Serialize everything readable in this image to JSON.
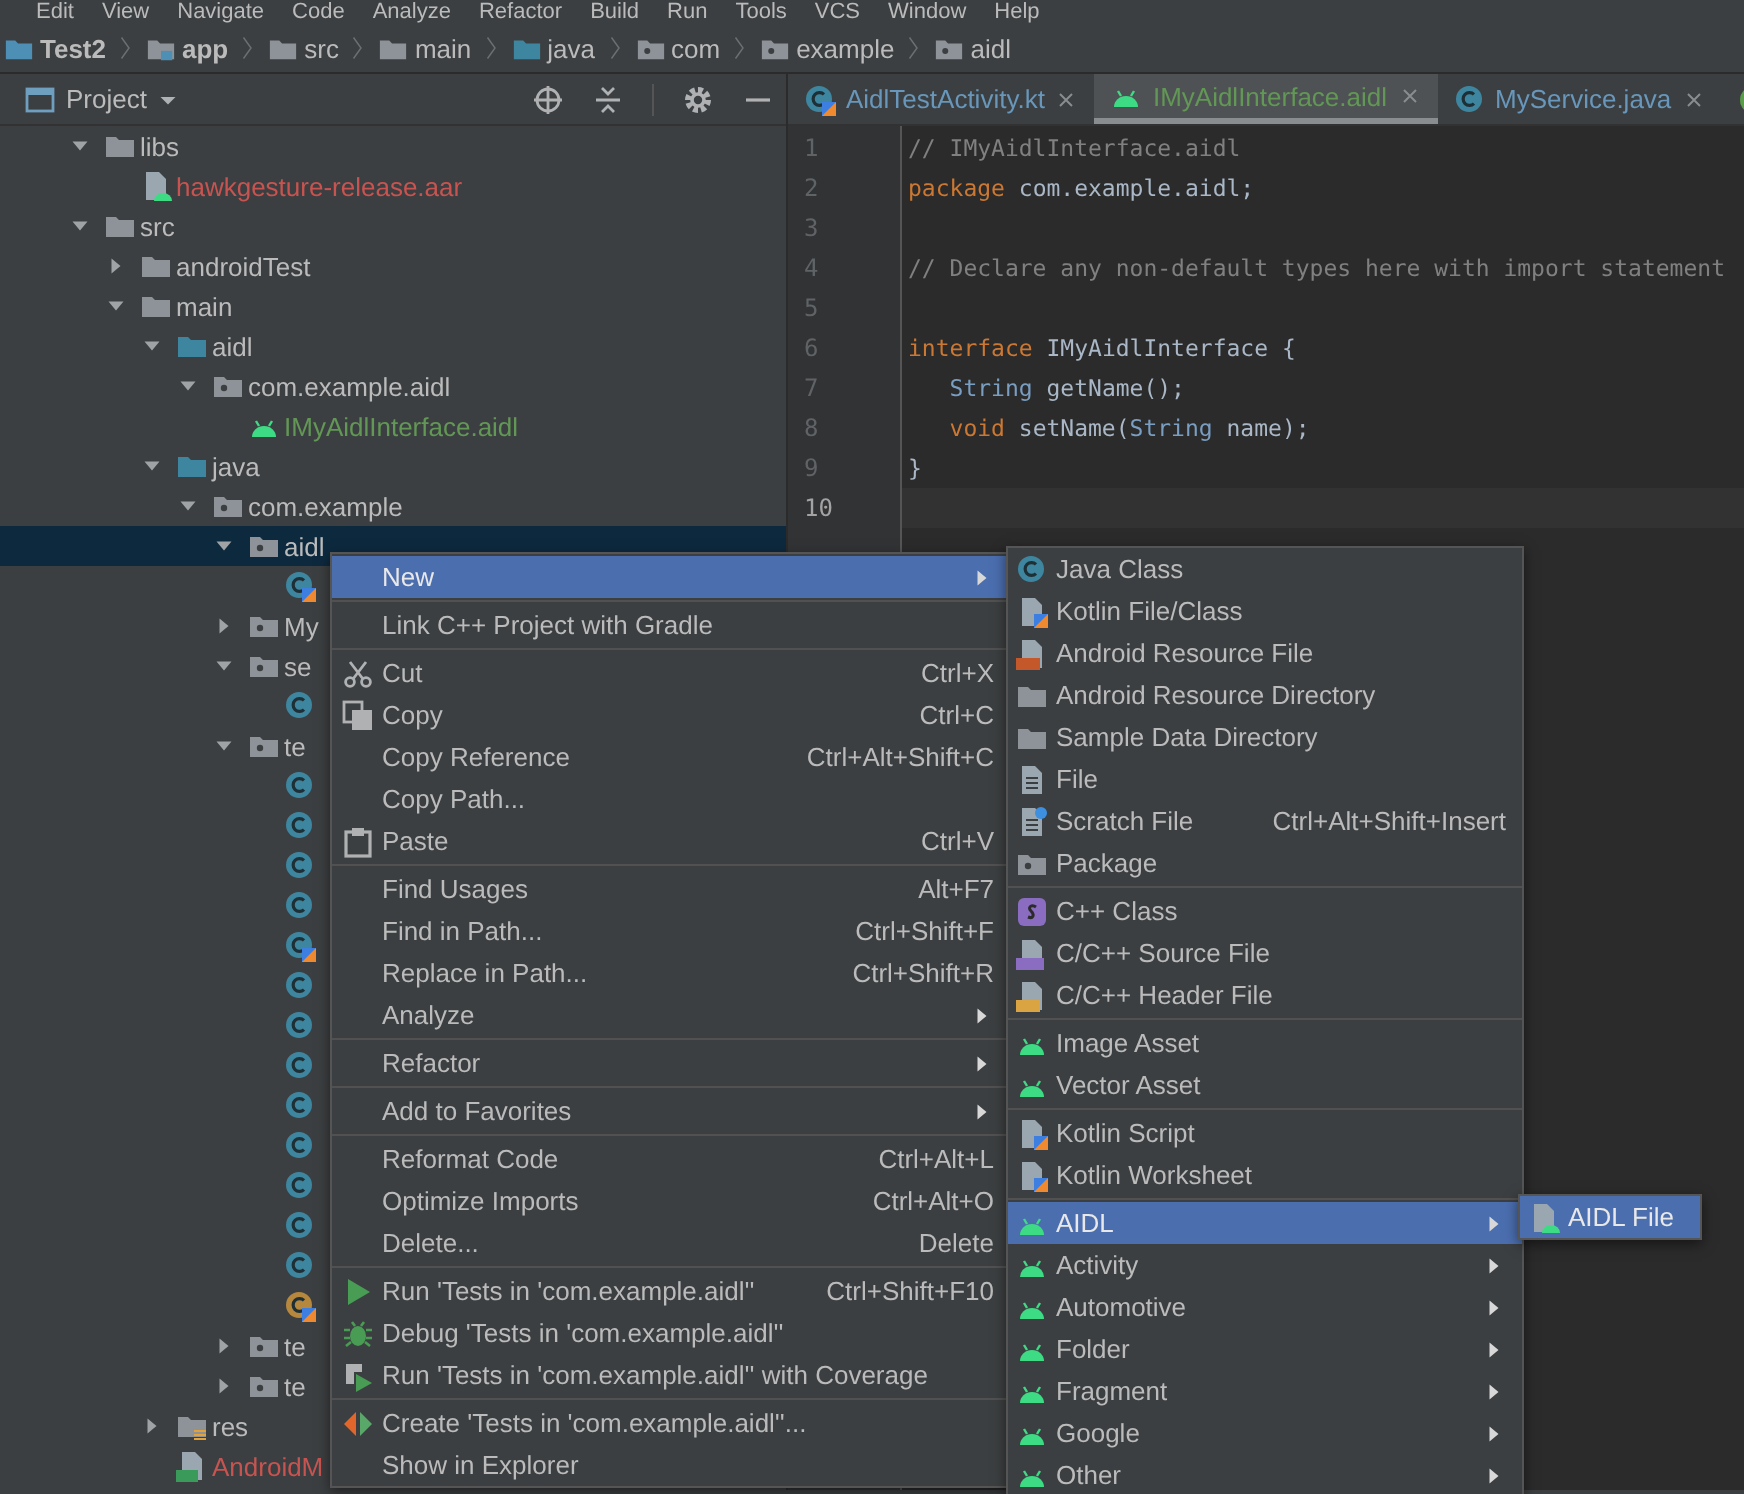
{
  "menu_bar": [
    "Edit",
    "View",
    "Navigate",
    "Code",
    "Analyze",
    "Refactor",
    "Build",
    "Run",
    "Tools",
    "VCS",
    "Window",
    "Help"
  ],
  "breadcrumbs": [
    {
      "label": "Test2",
      "kind": "project"
    },
    {
      "label": "app",
      "kind": "module"
    },
    {
      "label": "src",
      "kind": "folder"
    },
    {
      "label": "main",
      "kind": "folder"
    },
    {
      "label": "java",
      "kind": "source-folder"
    },
    {
      "label": "com",
      "kind": "package"
    },
    {
      "label": "example",
      "kind": "package"
    },
    {
      "label": "aidl",
      "kind": "package"
    }
  ],
  "project_panel": {
    "title": "Project"
  },
  "tree": [
    {
      "label": "libs",
      "kind": "folder",
      "expanded": true,
      "selected": false,
      "children": [
        {
          "label": "hawkgesture-release.aar",
          "kind": "aar",
          "color": "#c75450",
          "selected": false
        }
      ]
    },
    {
      "label": "src",
      "kind": "folder",
      "expanded": true,
      "selected": false,
      "children": [
        {
          "label": "androidTest",
          "kind": "folder",
          "expanded": false,
          "selected": false
        },
        {
          "label": "main",
          "kind": "folder",
          "expanded": true,
          "selected": false,
          "children": [
            {
              "label": "aidl",
              "kind": "source-folder",
              "expanded": true,
              "selected": false,
              "children": [
                {
                  "label": "com.example.aidl",
                  "kind": "package",
                  "expanded": true,
                  "selected": false,
                  "children": [
                    {
                      "label": "IMyAidlInterface.aidl",
                      "kind": "android",
                      "color": "#629755",
                      "selected": false
                    }
                  ]
                }
              ]
            },
            {
              "label": "java",
              "kind": "source-folder",
              "expanded": true,
              "selected": false,
              "children": [
                {
                  "label": "com.example",
                  "kind": "package",
                  "expanded": true,
                  "selected": false,
                  "children": [
                    {
                      "label": "aidl",
                      "kind": "package",
                      "expanded": true,
                      "selected": true,
                      "children": [
                        {
                          "kind": "kotlin-class",
                          "selected": false
                        }
                      ]
                    },
                    {
                      "label": "My",
                      "kind": "package",
                      "expanded": false,
                      "selected": false
                    },
                    {
                      "label": "se",
                      "kind": "package",
                      "expanded": true,
                      "selected": false,
                      "children": [
                        {
                          "kind": "class",
                          "selected": false
                        }
                      ]
                    },
                    {
                      "label": "te",
                      "kind": "package",
                      "expanded": true,
                      "selected": false,
                      "children": [
                        {
                          "kind": "class",
                          "selected": false
                        },
                        {
                          "kind": "class",
                          "selected": false
                        },
                        {
                          "kind": "class",
                          "selected": false
                        },
                        {
                          "kind": "class",
                          "selected": false
                        },
                        {
                          "kind": "kotlin-class",
                          "selected": false
                        },
                        {
                          "kind": "class",
                          "selected": false
                        },
                        {
                          "kind": "class",
                          "selected": false
                        },
                        {
                          "kind": "class",
                          "selected": false
                        },
                        {
                          "kind": "class",
                          "selected": false
                        },
                        {
                          "kind": "class",
                          "selected": false
                        },
                        {
                          "kind": "class",
                          "selected": false
                        },
                        {
                          "kind": "class",
                          "selected": false
                        },
                        {
                          "kind": "class",
                          "selected": false
                        },
                        {
                          "kind": "kotlin-object",
                          "selected": false
                        }
                      ]
                    },
                    {
                      "label": "te",
                      "kind": "package",
                      "expanded": false,
                      "selected": false
                    },
                    {
                      "label": "te",
                      "kind": "package",
                      "expanded": false,
                      "selected": false
                    }
                  ]
                }
              ]
            },
            {
              "label": "res",
              "kind": "res-folder",
              "expanded": false,
              "selected": false
            },
            {
              "label": "AndroidM",
              "kind": "manifest",
              "color": "#c75450",
              "selected": false
            }
          ]
        }
      ]
    }
  ],
  "editor_tabs": [
    {
      "label": "AidlTestActivity.kt",
      "kind": "kotlin-class",
      "color": "#6897bb",
      "selected": false
    },
    {
      "label": "IMyAidlInterface.aidl",
      "kind": "android",
      "color": "#629755",
      "selected": true
    },
    {
      "label": "MyService.java",
      "kind": "class",
      "color": "#6897bb",
      "selected": false
    },
    {
      "kind": "interface",
      "selected": false
    }
  ],
  "editor_lines": [
    {
      "number": "1",
      "current": false,
      "segments": [
        {
          "kind": "comment",
          "text": "// IMyAidlInterface.aidl"
        }
      ]
    },
    {
      "number": "2",
      "current": false,
      "segments": [
        {
          "kind": "keyword",
          "text": "package "
        },
        {
          "kind": "plain",
          "text": "com.example.aidl;"
        }
      ]
    },
    {
      "number": "3",
      "current": false
    },
    {
      "number": "4",
      "current": false,
      "segments": [
        {
          "kind": "comment",
          "text": "// Declare any non-default types here with import statement"
        }
      ]
    },
    {
      "number": "5",
      "current": false
    },
    {
      "number": "6",
      "current": false,
      "segments": [
        {
          "kind": "keyword",
          "text": "interface "
        },
        {
          "kind": "plain",
          "text": "IMyAidlInterface {"
        }
      ]
    },
    {
      "number": "7",
      "current": false,
      "segments": [
        {
          "kind": "type",
          "text": "   String "
        },
        {
          "kind": "plain",
          "text": "getName();"
        }
      ]
    },
    {
      "number": "8",
      "current": false,
      "segments": [
        {
          "kind": "keyword",
          "text": "   void "
        },
        {
          "kind": "plain",
          "text": "setName("
        },
        {
          "kind": "type",
          "text": "String "
        },
        {
          "kind": "plain",
          "text": "name);"
        }
      ]
    },
    {
      "number": "9",
      "current": false,
      "segments": [
        {
          "kind": "plain",
          "text": "}"
        }
      ]
    },
    {
      "number": "10",
      "current": true
    }
  ],
  "context_menu": [
    {
      "kind": "text",
      "label": "New",
      "submenu": true,
      "selected": true
    },
    {
      "kind": "separator"
    },
    {
      "kind": "text",
      "label": "Link C++ Project with Gradle",
      "selected": false
    },
    {
      "kind": "separator"
    },
    {
      "kind": "scissors",
      "label": "Cut",
      "shortcut": "Ctrl+X",
      "selected": false
    },
    {
      "kind": "copy",
      "label": "Copy",
      "shortcut": "Ctrl+C",
      "selected": false
    },
    {
      "kind": "text",
      "label": "Copy Reference",
      "shortcut": "Ctrl+Alt+Shift+C",
      "selected": false
    },
    {
      "kind": "text",
      "label": "Copy Path...",
      "selected": false
    },
    {
      "kind": "paste",
      "label": "Paste",
      "shortcut": "Ctrl+V",
      "selected": false
    },
    {
      "kind": "separator"
    },
    {
      "kind": "text",
      "label": "Find Usages",
      "shortcut": "Alt+F7",
      "selected": false
    },
    {
      "kind": "text",
      "label": "Find in Path...",
      "shortcut": "Ctrl+Shift+F",
      "selected": false
    },
    {
      "kind": "text",
      "label": "Replace in Path...",
      "shortcut": "Ctrl+Shift+R",
      "selected": false
    },
    {
      "kind": "text",
      "label": "Analyze",
      "submenu": true,
      "selected": false
    },
    {
      "kind": "separator"
    },
    {
      "kind": "text",
      "label": "Refactor",
      "submenu": true,
      "selected": false
    },
    {
      "kind": "separator"
    },
    {
      "kind": "text",
      "label": "Add to Favorites",
      "submenu": true,
      "selected": false
    },
    {
      "kind": "separator"
    },
    {
      "kind": "text",
      "label": "Reformat Code",
      "shortcut": "Ctrl+Alt+L",
      "selected": false
    },
    {
      "kind": "text",
      "label": "Optimize Imports",
      "shortcut": "Ctrl+Alt+O",
      "selected": false
    },
    {
      "kind": "text",
      "label": "Delete...",
      "shortcut": "Delete",
      "selected": false
    },
    {
      "kind": "separator"
    },
    {
      "kind": "run",
      "label": "Run 'Tests in 'com.example.aidl''",
      "shortcut": "Ctrl+Shift+F10",
      "selected": false
    },
    {
      "kind": "debug",
      "label": "Debug 'Tests in 'com.example.aidl''",
      "selected": false
    },
    {
      "kind": "coverage",
      "label": "Run 'Tests in 'com.example.aidl'' with Coverage",
      "selected": false
    },
    {
      "kind": "separator"
    },
    {
      "kind": "create-test",
      "label": "Create 'Tests in 'com.example.aidl''...",
      "selected": false
    },
    {
      "kind": "text",
      "label": "Show in Explorer",
      "selected": false
    }
  ],
  "new_submenu": [
    {
      "kind": "class",
      "label": "Java Class",
      "selected": false
    },
    {
      "kind": "kotlin-file",
      "label": "Kotlin File/Class",
      "selected": false
    },
    {
      "kind": "res-file",
      "label": "Android Resource File",
      "selected": false
    },
    {
      "kind": "folder",
      "label": "Android Resource Directory",
      "selected": false
    },
    {
      "kind": "folder",
      "label": "Sample Data Directory",
      "selected": false
    },
    {
      "kind": "file-lines",
      "label": "File",
      "selected": false
    },
    {
      "kind": "scratch",
      "label": "Scratch File",
      "shortcut": "Ctrl+Alt+Shift+Insert",
      "selected": false
    },
    {
      "kind": "package",
      "label": "Package",
      "selected": false
    },
    {
      "kind": "separator"
    },
    {
      "kind": "cpp-class",
      "label": "C++ Class",
      "selected": false
    },
    {
      "kind": "cpp-source",
      "label": "C/C++ Source File",
      "selected": false
    },
    {
      "kind": "cpp-header",
      "label": "C/C++ Header File",
      "selected": false
    },
    {
      "kind": "separator"
    },
    {
      "kind": "android",
      "label": "Image Asset",
      "selected": false
    },
    {
      "kind": "android",
      "label": "Vector Asset",
      "selected": false
    },
    {
      "kind": "separator"
    },
    {
      "kind": "kotlin-file",
      "label": "Kotlin Script",
      "selected": false
    },
    {
      "kind": "kotlin-file",
      "label": "Kotlin Worksheet",
      "selected": false
    },
    {
      "kind": "separator"
    },
    {
      "kind": "android",
      "label": "AIDL",
      "submenu": true,
      "selected": true
    },
    {
      "kind": "android",
      "label": "Activity",
      "submenu": true,
      "selected": false
    },
    {
      "kind": "android",
      "label": "Automotive",
      "submenu": true,
      "selected": false
    },
    {
      "kind": "android",
      "label": "Folder",
      "submenu": true,
      "selected": false
    },
    {
      "kind": "android",
      "label": "Fragment",
      "submenu": true,
      "selected": false
    },
    {
      "kind": "android",
      "label": "Google",
      "submenu": true,
      "selected": false
    },
    {
      "kind": "android",
      "label": "Other",
      "submenu": true,
      "selected": false
    }
  ],
  "aidl_submenu": [
    {
      "kind": "aidl-file",
      "label": "AIDL File",
      "selected": true
    }
  ]
}
